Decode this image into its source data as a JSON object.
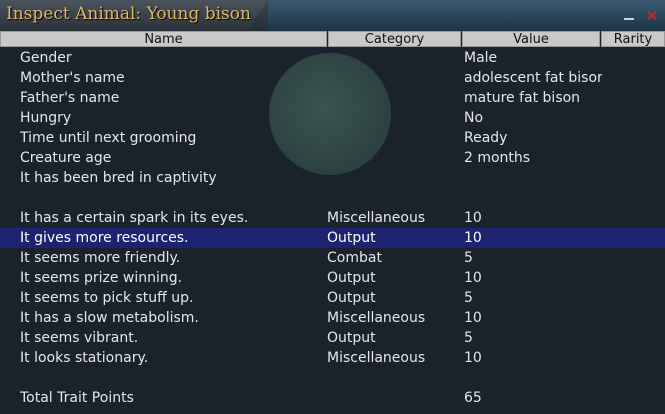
{
  "window": {
    "title": "Inspect Animal: Young bison",
    "minimize_icon": "minimize-icon",
    "close_icon": "close-icon",
    "close_glyph": "✕"
  },
  "columns": {
    "name": "Name",
    "category": "Category",
    "value": "Value",
    "rarity": "Rarity"
  },
  "rows": [
    {
      "name": "Gender",
      "category": "",
      "value": "Male"
    },
    {
      "name": "Mother's name",
      "category": "",
      "value": "adolescent fat bisor"
    },
    {
      "name": "Father's name",
      "category": "",
      "value": "mature fat bison"
    },
    {
      "name": "Hungry",
      "category": "",
      "value": "No"
    },
    {
      "name": "Time until next grooming",
      "category": "",
      "value": "Ready"
    },
    {
      "name": "Creature age",
      "category": "",
      "value": "2 months"
    },
    {
      "name": "It has been bred in captivity",
      "category": "",
      "value": ""
    },
    {
      "name": "",
      "category": "",
      "value": ""
    },
    {
      "name": "It has a certain spark in its eyes.",
      "category": "Miscellaneous",
      "value": "10"
    },
    {
      "name": "It gives more resources.",
      "category": "Output",
      "value": "10"
    },
    {
      "name": "It seems more friendly.",
      "category": "Combat",
      "value": "5"
    },
    {
      "name": "It seems prize winning.",
      "category": "Output",
      "value": "10"
    },
    {
      "name": "It seems to pick stuff up.",
      "category": "Output",
      "value": "5"
    },
    {
      "name": "It has a slow metabolism.",
      "category": "Miscellaneous",
      "value": "10"
    },
    {
      "name": "It seems vibrant.",
      "category": "Output",
      "value": "5"
    },
    {
      "name": "It looks stationary.",
      "category": "Miscellaneous",
      "value": "10"
    },
    {
      "name": "",
      "category": "",
      "value": ""
    },
    {
      "name": "Total Trait Points",
      "category": "",
      "value": "65"
    }
  ],
  "selected_row_index": 9,
  "colors": {
    "title_text": "#e0b86a",
    "selected_row": "#1d2370",
    "header_bg": "#c9c9c9",
    "close_button": "#e02020"
  }
}
